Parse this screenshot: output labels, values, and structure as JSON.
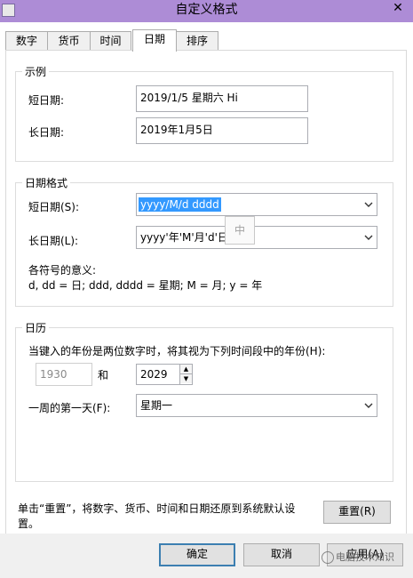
{
  "window": {
    "title": "自定义格式",
    "close_glyph": "✕"
  },
  "tabs": [
    {
      "label": "数字"
    },
    {
      "label": "货币"
    },
    {
      "label": "时间"
    },
    {
      "label": "日期"
    },
    {
      "label": "排序"
    }
  ],
  "example": {
    "title": "示例",
    "short_label": "短日期:",
    "short_value": "2019/1/5 星期六 Hi",
    "long_label": "长日期:",
    "long_value": "2019年1月5日"
  },
  "date_format": {
    "title": "日期格式",
    "short_label": "短日期(S):",
    "short_value": "yyyy/M/d dddd",
    "long_label": "长日期(L):",
    "long_value": "yyyy'年'M'月'd'日'",
    "meaning_title": "各符号的意义:",
    "meaning_text": "d, dd = 日;  ddd, dddd = 星期;  M = 月;  y = 年"
  },
  "ime_indicator": "中",
  "calendar": {
    "title": "日历",
    "two_digit_text": "当键入的年份是两位数字时，将其视为下列时间段中的年份(H):",
    "year_from": "1930",
    "and_label": "和",
    "year_to": "2029",
    "first_day_label": "一周的第一天(F):",
    "first_day_value": "星期一"
  },
  "reset": {
    "text_line1": "单击“重置”，将数字、货币、时间和日期还原到系统默认设",
    "text_line2": "置。",
    "button_label": "重置(R)"
  },
  "footer": {
    "ok_label": "确定",
    "cancel_label": "取消",
    "apply_label": "应用(A)"
  },
  "watermark": "电脑技术知识"
}
